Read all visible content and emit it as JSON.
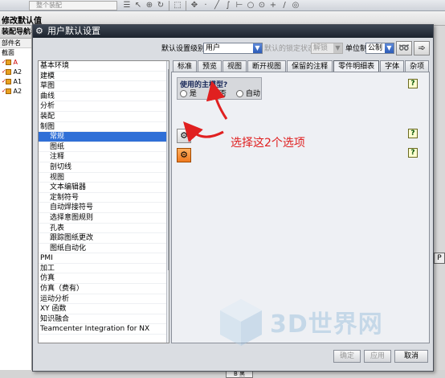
{
  "app": {
    "toolbar_combo_text": "整个装配",
    "strip_label": "修改默认值",
    "nav_panel": {
      "title": "装配导航器",
      "column": "部件名",
      "rows": [
        {
          "text": "截面"
        },
        {
          "text": "A"
        },
        {
          "text": "A2"
        },
        {
          "text": "A1"
        },
        {
          "text": "A2"
        }
      ]
    },
    "right_edge_chip": "P",
    "bottom_chip": "B 黑"
  },
  "dialog": {
    "title": "用户默认设置",
    "top_row": {
      "level_label": "默认设置级别",
      "level_value": "用户",
      "lock_label": "默认的锁定状态",
      "lock_value": "解锁",
      "unit_label": "单位制",
      "unit_value": "公制"
    },
    "categories": [
      {
        "label": "基本环境",
        "child": false,
        "selected": false
      },
      {
        "label": "建模",
        "child": false,
        "selected": false
      },
      {
        "label": "草图",
        "child": false,
        "selected": false
      },
      {
        "label": "曲线",
        "child": false,
        "selected": false
      },
      {
        "label": "分析",
        "child": false,
        "selected": false
      },
      {
        "label": "装配",
        "child": false,
        "selected": false
      },
      {
        "label": "制图",
        "child": false,
        "selected": false
      },
      {
        "label": "常规",
        "child": true,
        "selected": true
      },
      {
        "label": "图纸",
        "child": true,
        "selected": false
      },
      {
        "label": "注释",
        "child": true,
        "selected": false
      },
      {
        "label": "剖切线",
        "child": true,
        "selected": false
      },
      {
        "label": "视图",
        "child": true,
        "selected": false
      },
      {
        "label": "文本编辑器",
        "child": true,
        "selected": false
      },
      {
        "label": "定制符号",
        "child": true,
        "selected": false
      },
      {
        "label": "自动焊接符号",
        "child": true,
        "selected": false
      },
      {
        "label": "选择意图规则",
        "child": true,
        "selected": false
      },
      {
        "label": "孔表",
        "child": true,
        "selected": false
      },
      {
        "label": "跟踪图纸更改",
        "child": true,
        "selected": false
      },
      {
        "label": "图纸自动化",
        "child": true,
        "selected": false
      },
      {
        "label": "PMI",
        "child": false,
        "selected": false
      },
      {
        "label": "加工",
        "child": false,
        "selected": false
      },
      {
        "label": "仿真",
        "child": false,
        "selected": false
      },
      {
        "label": "仿真（费有）",
        "child": false,
        "selected": false
      },
      {
        "label": "运动分析",
        "child": false,
        "selected": false
      },
      {
        "label": "XY 函数",
        "child": false,
        "selected": false
      },
      {
        "label": "知识融合",
        "child": false,
        "selected": false
      },
      {
        "label": "Teamcenter Integration for NX",
        "child": false,
        "selected": false
      }
    ],
    "tabs": [
      {
        "label": "标准",
        "active": false
      },
      {
        "label": "预览",
        "active": false
      },
      {
        "label": "视图",
        "active": false
      },
      {
        "label": "断开视图",
        "active": false
      },
      {
        "label": "保留的注释",
        "active": false
      },
      {
        "label": "零件明细表",
        "active": true
      },
      {
        "label": "字体",
        "active": false
      },
      {
        "label": "杂项",
        "active": false
      }
    ],
    "master_model": {
      "title": "使用的主模型?",
      "options": [
        {
          "label": "是",
          "selected": false
        },
        {
          "label": "否",
          "selected": true
        },
        {
          "label": "自动",
          "selected": false
        }
      ]
    },
    "help_glyph": "?",
    "annotation": "选择这2个选项",
    "buttons": {
      "ok": "确定",
      "apply": "应用",
      "cancel": "取消"
    }
  },
  "watermark": {
    "text": "3D世界网"
  },
  "colors": {
    "title_bar": "#1c232d",
    "selection": "#2f6fd7",
    "annotation": "#e02020",
    "arrow": "#e02020"
  }
}
